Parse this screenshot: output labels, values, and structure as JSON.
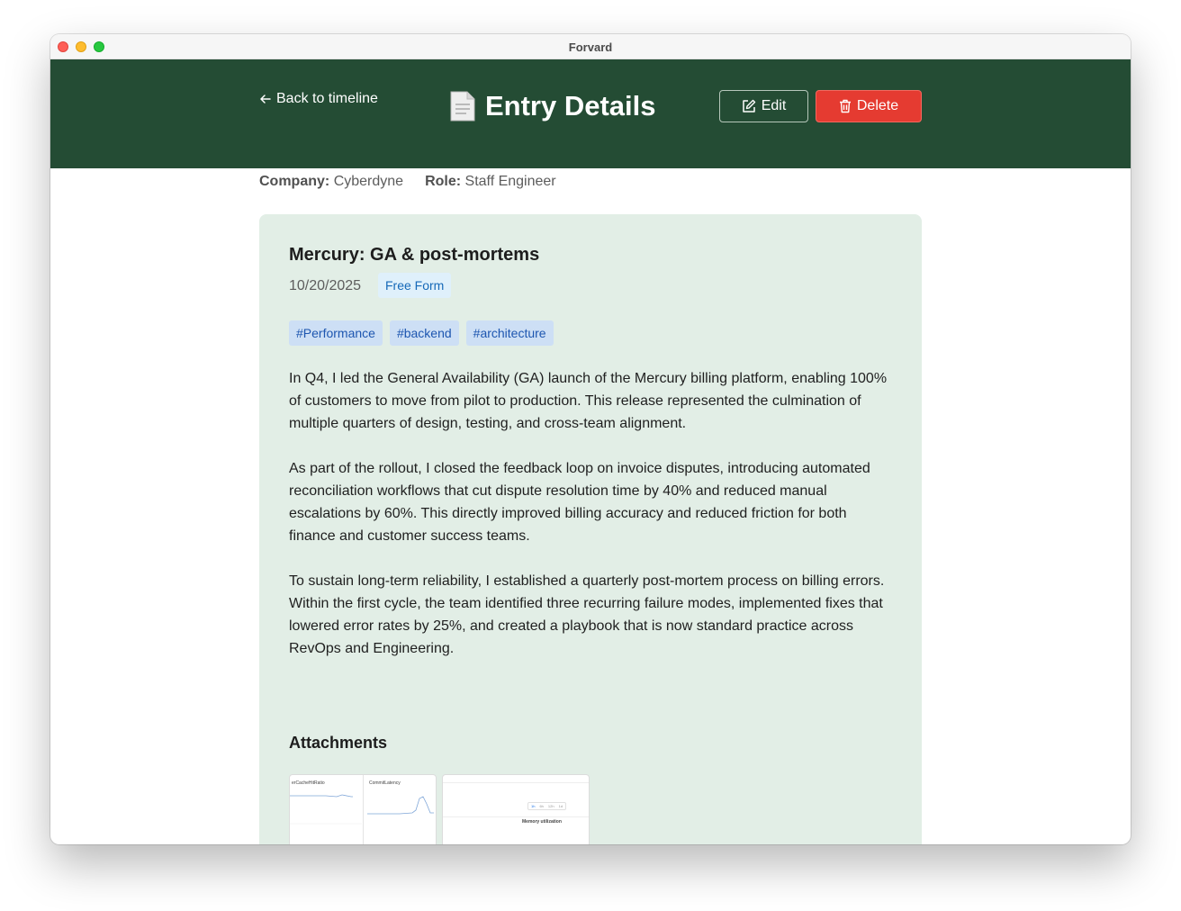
{
  "window": {
    "title": "Forvard"
  },
  "header": {
    "back_label": "Back to timeline",
    "page_title": "Entry Details",
    "edit_label": "Edit",
    "delete_label": "Delete"
  },
  "meta": {
    "company_label": "Company:",
    "company_value": "Cyberdyne",
    "role_label": "Role:",
    "role_value": "Staff Engineer"
  },
  "entry": {
    "title": "Mercury: GA & post-mortems",
    "date": "10/20/2025",
    "type": "Free Form",
    "tags": [
      "#Performance",
      "#backend",
      "#architecture"
    ],
    "paragraphs": [
      "In Q4, I led the General Availability (GA) launch of the Mercury billing platform, enabling 100% of customers to move from pilot to production. This release represented the culmination of multiple quarters of design, testing, and cross-team alignment.",
      "As part of the rollout, I closed the feedback loop on invoice disputes, introducing automated reconciliation workflows that cut dispute resolution time by 40% and reduced manual escalations by 60%. This directly improved billing accuracy and reduced friction for both finance and customer success teams.",
      "To sustain long-term reliability, I established a quarterly post-mortem process on billing errors. Within the first cycle, the team identified three recurring failure modes, implemented fixes that lowered error rates by 25%, and created a playbook that is now standard practice across RevOps and Engineering."
    ],
    "attachments_heading": "Attachments",
    "attachments": [
      {
        "left_label": "erCacheHitRatio",
        "right_label": "CommitLatency"
      },
      {
        "label": "Memory utilization",
        "ranges": [
          "1h",
          "6h",
          "12h",
          "1d"
        ]
      }
    ]
  },
  "colors": {
    "header_bg": "#244c34",
    "card_bg": "#e2eee6",
    "delete_bg": "#e53b31",
    "tag_bg": "#cddff5",
    "tag_text": "#1d56b0",
    "badge_bg": "#dff0fb",
    "badge_text": "#1669b8"
  }
}
